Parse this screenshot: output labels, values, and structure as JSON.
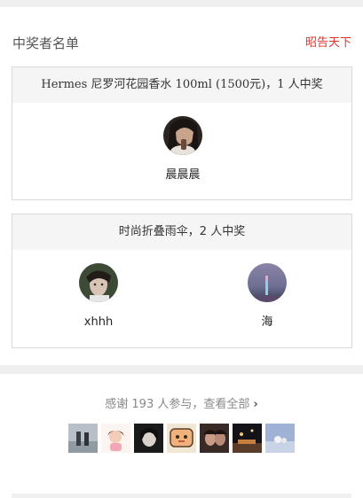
{
  "header": {
    "title": "中奖者名单",
    "share_label": "昭告天下"
  },
  "prizes": [
    {
      "label": "Hermes 尼罗河花园香水 100ml (1500元)，1 人中奖",
      "winners": [
        {
          "name": "晨晨晨"
        }
      ]
    },
    {
      "label": "时尚折叠雨伞，2 人中奖",
      "winners": [
        {
          "name": "xhhh"
        },
        {
          "name": "海"
        }
      ]
    }
  ],
  "participants": {
    "thanks_text": "感谢 193 人参与，查看全部",
    "chevron": "›"
  }
}
